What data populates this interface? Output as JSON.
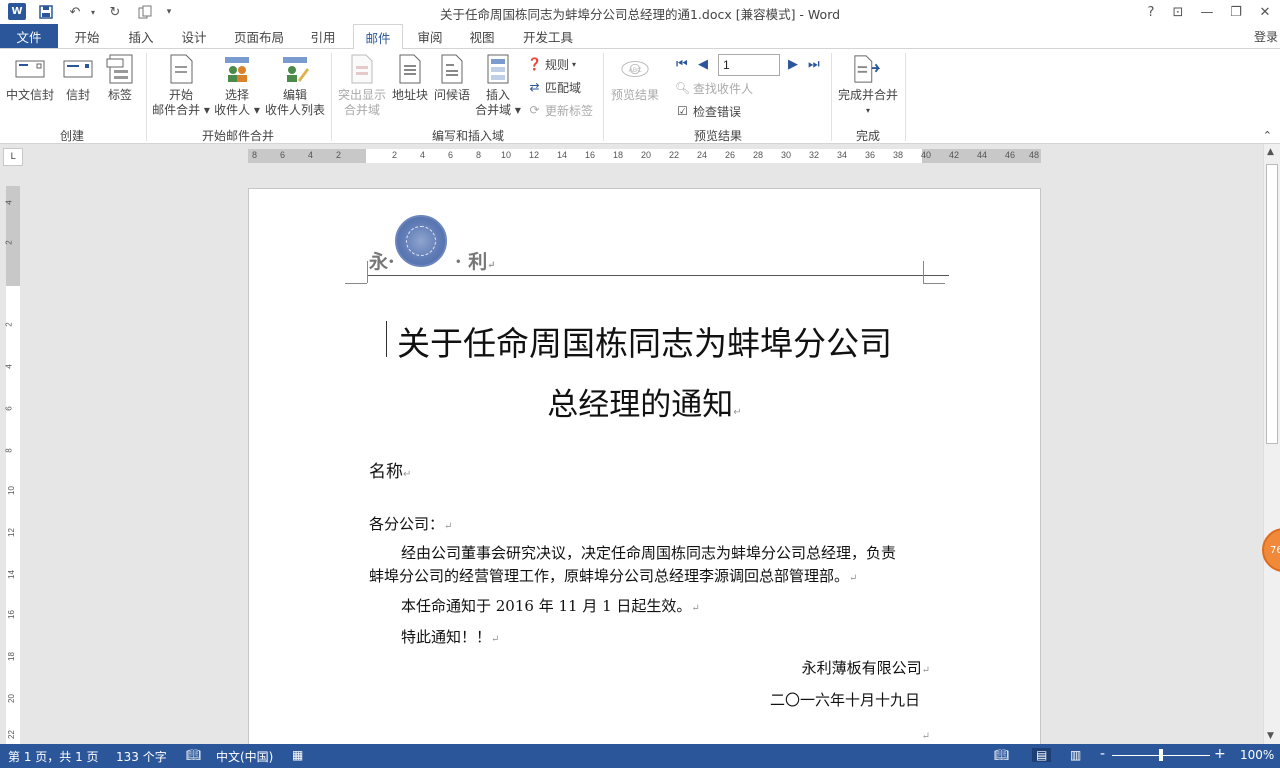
{
  "window": {
    "title": "关于任命周国栋同志为蚌埠分公司总经理的通1.docx [兼容模式] - Word",
    "app_icon": "W",
    "quick_access": [
      "save-icon",
      "undo-icon",
      "redo-icon",
      "template-icon",
      "customize-icon"
    ],
    "buttons": {
      "help": "?",
      "ribbon_display": "⊡",
      "minimize": "—",
      "restore": "❐",
      "close": "✕"
    }
  },
  "tabs": {
    "file": "文件",
    "items": [
      "开始",
      "插入",
      "设计",
      "页面布局",
      "引用",
      "邮件",
      "审阅",
      "视图",
      "开发工具"
    ],
    "active": "邮件",
    "login": "登录"
  },
  "ribbon": {
    "groups": {
      "create": "创建",
      "start_merge": "开始邮件合并",
      "write_insert": "编写和插入域",
      "preview": "预览结果",
      "finish": "完成"
    },
    "buttons": {
      "chinese_envelope": "中文信封",
      "envelope": "信封",
      "labels": "标签",
      "start_merge_line1": "开始",
      "start_merge_line2": "邮件合并",
      "select_recipients_line1": "选择",
      "select_recipients_line2": "收件人",
      "edit_list_line1": "编辑",
      "edit_list_line2": "收件人列表",
      "highlight_line1": "突出显示",
      "highlight_line2": "合并域",
      "address_block": "地址块",
      "greeting": "问候语",
      "insert_field_line1": "插入",
      "insert_field_line2": "合并域",
      "rules": "规则",
      "match_fields": "匹配域",
      "update_labels": "更新标签",
      "preview_results": "预览结果",
      "find_recipient": "查找收件人",
      "check_errors": "检查错误",
      "finish_merge": "完成并合并"
    },
    "record_number": "1"
  },
  "rulers": {
    "horizontal_ticks": [
      "8",
      "6",
      "4",
      "2",
      "2",
      "4",
      "6",
      "8",
      "10",
      "12",
      "14",
      "16",
      "18",
      "20",
      "22",
      "24",
      "26",
      "28",
      "30",
      "32",
      "34",
      "36",
      "38",
      "40",
      "42",
      "44",
      "46",
      "48"
    ],
    "vertical_ticks": [
      "4",
      "2",
      "2",
      "4",
      "6",
      "8",
      "10",
      "12",
      "14",
      "16",
      "18",
      "20",
      "22"
    ],
    "corner": "L"
  },
  "document": {
    "header_left": "永·",
    "header_right": "· 利",
    "title_line1": "关于任命周国栋同志为蚌埠分公司",
    "title_line2": "总经理的通知",
    "name_field": "名称",
    "greeting": "各分公司：",
    "body_line1": "经由公司董事会研究决议，决定任命周国栋同志为蚌埠分公司总经理，负责",
    "body_line2": "蚌埠分公司的经营管理工作，原蚌埠分公司总经理李源调回总部管理部。",
    "effective": "本任命通知于 2016 年 11 月 1 日起生效。",
    "closing": "特此通知！！",
    "company": "永利薄板有限公司",
    "date": "二〇一六年十月十九日",
    "para_mark": "↵"
  },
  "side_badge": "76",
  "statusbar": {
    "page": "第 1 页，共 1 页",
    "words": "133 个字",
    "language": "中文(中国)",
    "zoom": "100%",
    "zoom_minus": "-",
    "zoom_plus": "+"
  }
}
